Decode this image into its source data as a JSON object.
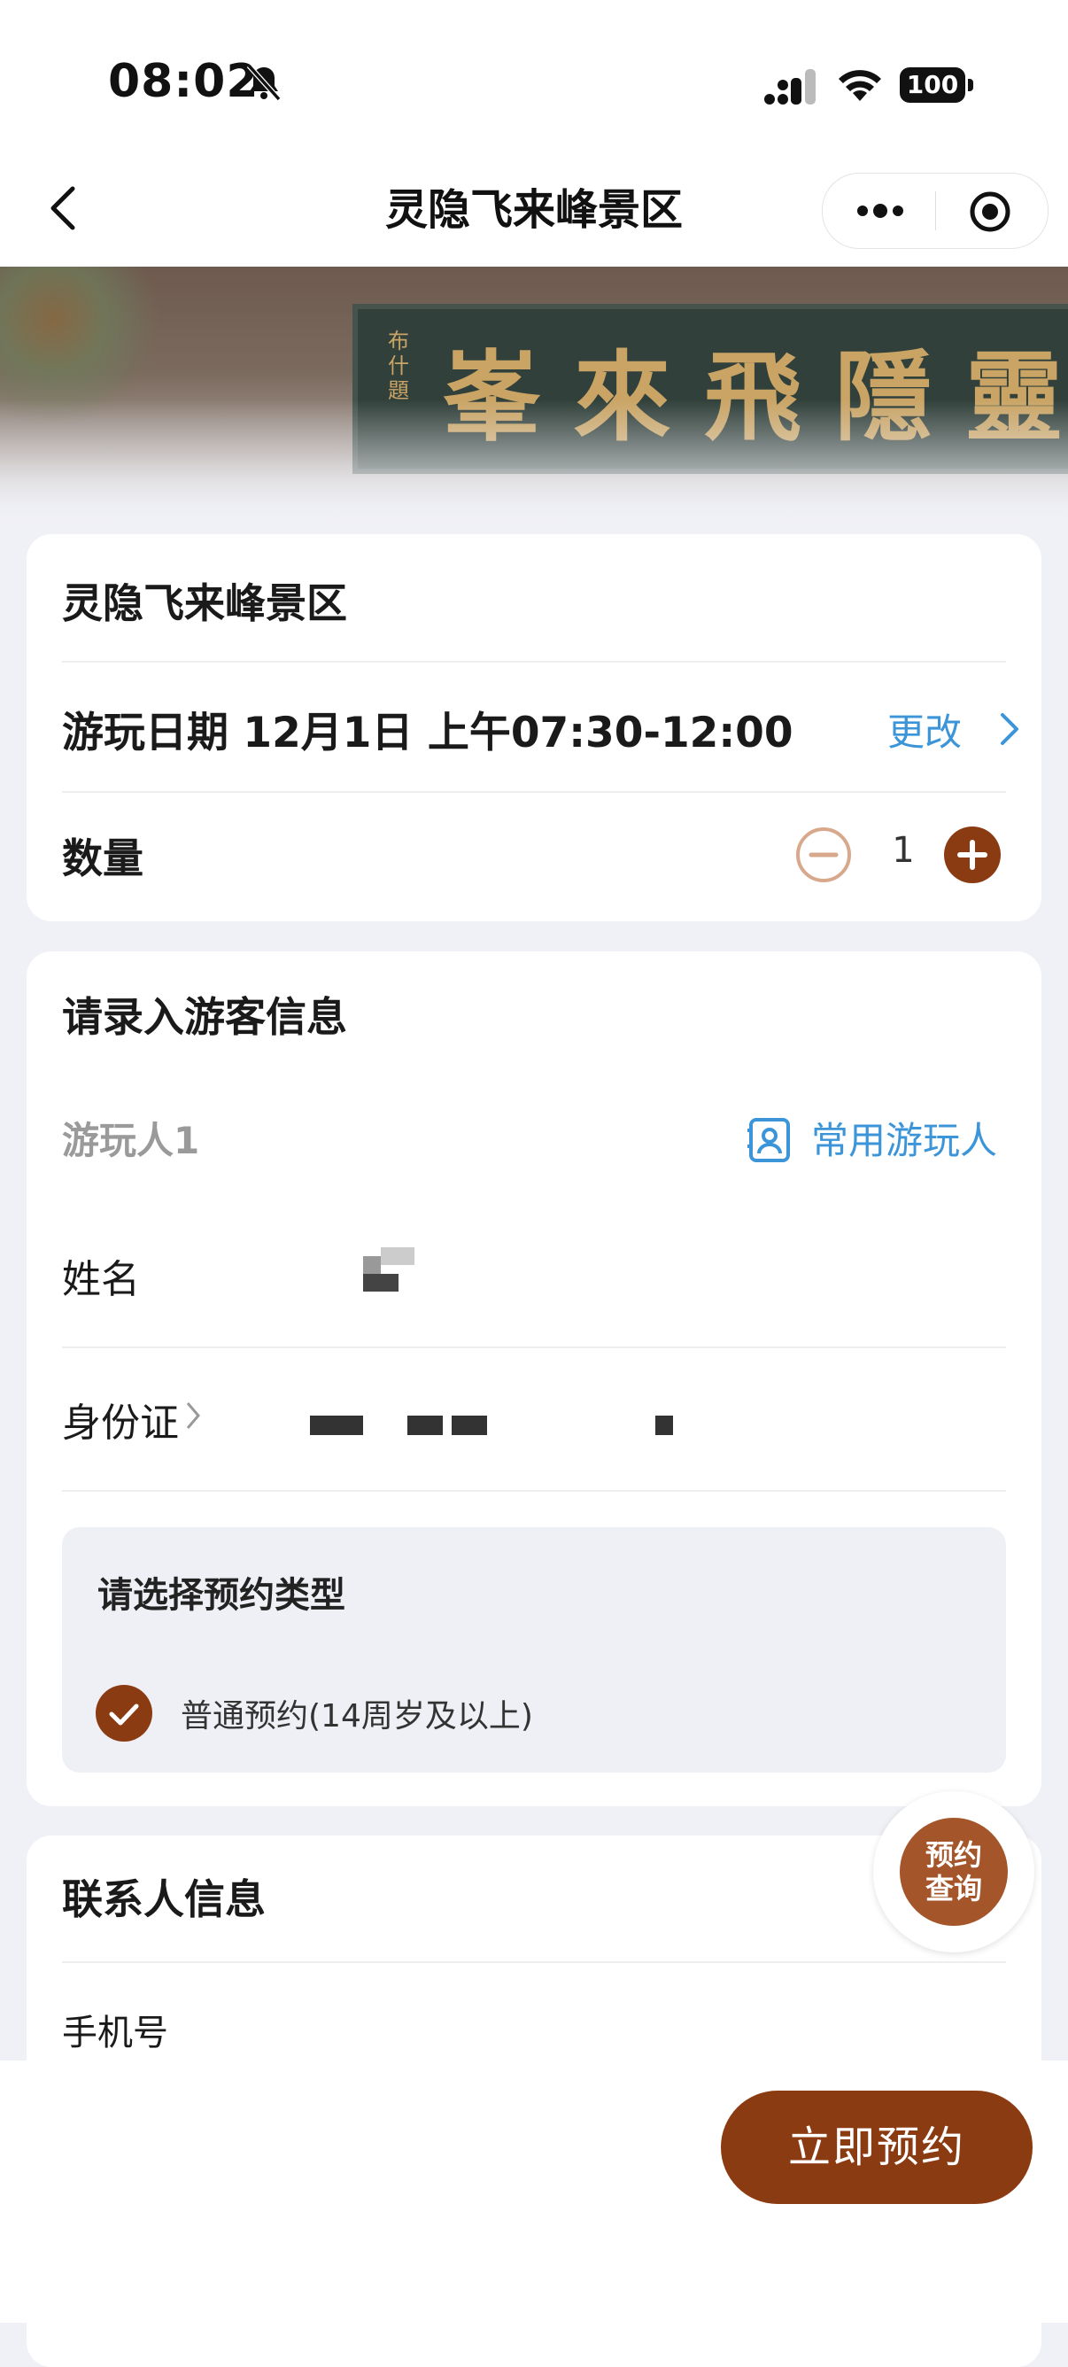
{
  "status_bar": {
    "time": "08:02",
    "battery": "100"
  },
  "nav": {
    "title": "灵隐飞来峰景区"
  },
  "banner": {
    "plaque_chars": [
      "峯",
      "來",
      "飛",
      "隱",
      "靈"
    ],
    "plaque_small": "布什題"
  },
  "ticket": {
    "scenic_name": "灵隐飞来峰景区",
    "date_text": "游玩日期 12月1日 上午07:30-12:00",
    "change_label": "更改",
    "quantity_label": "数量",
    "quantity": "1"
  },
  "visitor": {
    "section_title": "请录入游客信息",
    "traveler_label": "游玩人1",
    "frequent_label": "常用游玩人",
    "name_label": "姓名",
    "id_label": "身份证",
    "booking_type_title": "请选择预约类型",
    "booking_type_option": "普通预约(14周岁及以上)"
  },
  "contact": {
    "section_title": "联系人信息",
    "phone_label": "手机号"
  },
  "float_button": {
    "line1": "预约",
    "line2": "查询"
  },
  "footer": {
    "book_button": "立即预约"
  },
  "colors": {
    "accent": "#8b3b12",
    "link": "#3b95d8",
    "background": "#f0f1f6"
  }
}
